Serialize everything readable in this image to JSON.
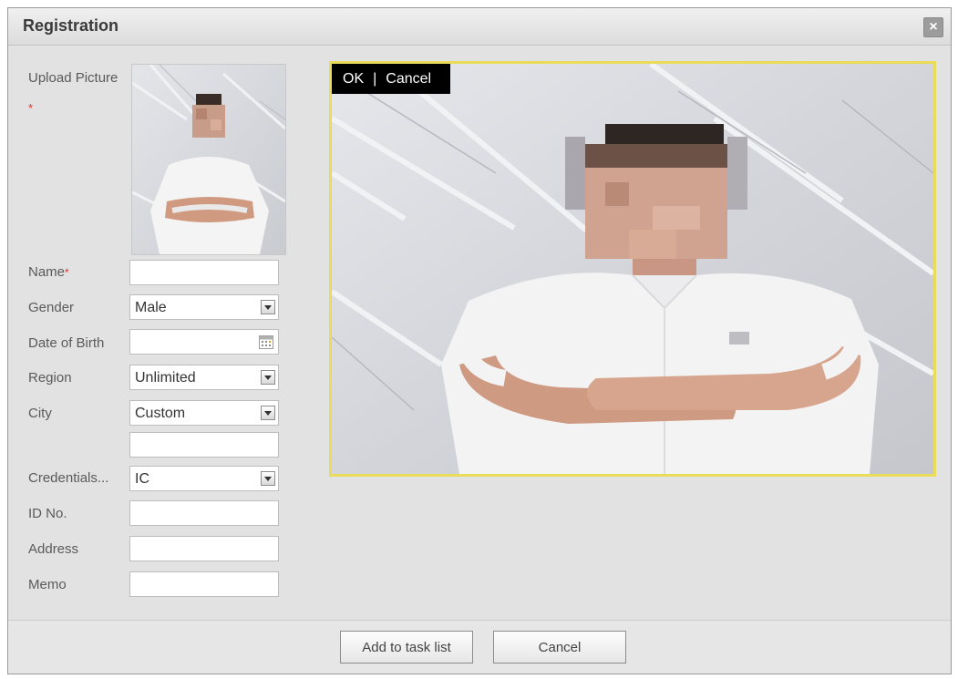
{
  "dialog": {
    "title": "Registration",
    "close_icon": "close-icon"
  },
  "form": {
    "upload_picture_label": "Upload Picture",
    "name_label": "Name",
    "required_mark": "*",
    "gender_label": "Gender",
    "gender_value": "Male",
    "dob_label": "Date of Birth",
    "dob_value": "",
    "region_label": "Region",
    "region_value": "Unlimited",
    "city_label": "City",
    "city_value": "Custom",
    "city_custom_value": "",
    "credentials_label": "Credentials...",
    "credentials_value": "IC",
    "id_label": "ID No.",
    "address_label": "Address",
    "memo_label": "Memo"
  },
  "preview": {
    "ok_label": "OK",
    "separator": "|",
    "cancel_label": "Cancel"
  },
  "footer": {
    "add_label": "Add to task list",
    "cancel_label": "Cancel"
  },
  "colors": {
    "crop_border": "#e8dc5a",
    "required": "#e23030",
    "dialog_bg": "#e2e2e2"
  }
}
